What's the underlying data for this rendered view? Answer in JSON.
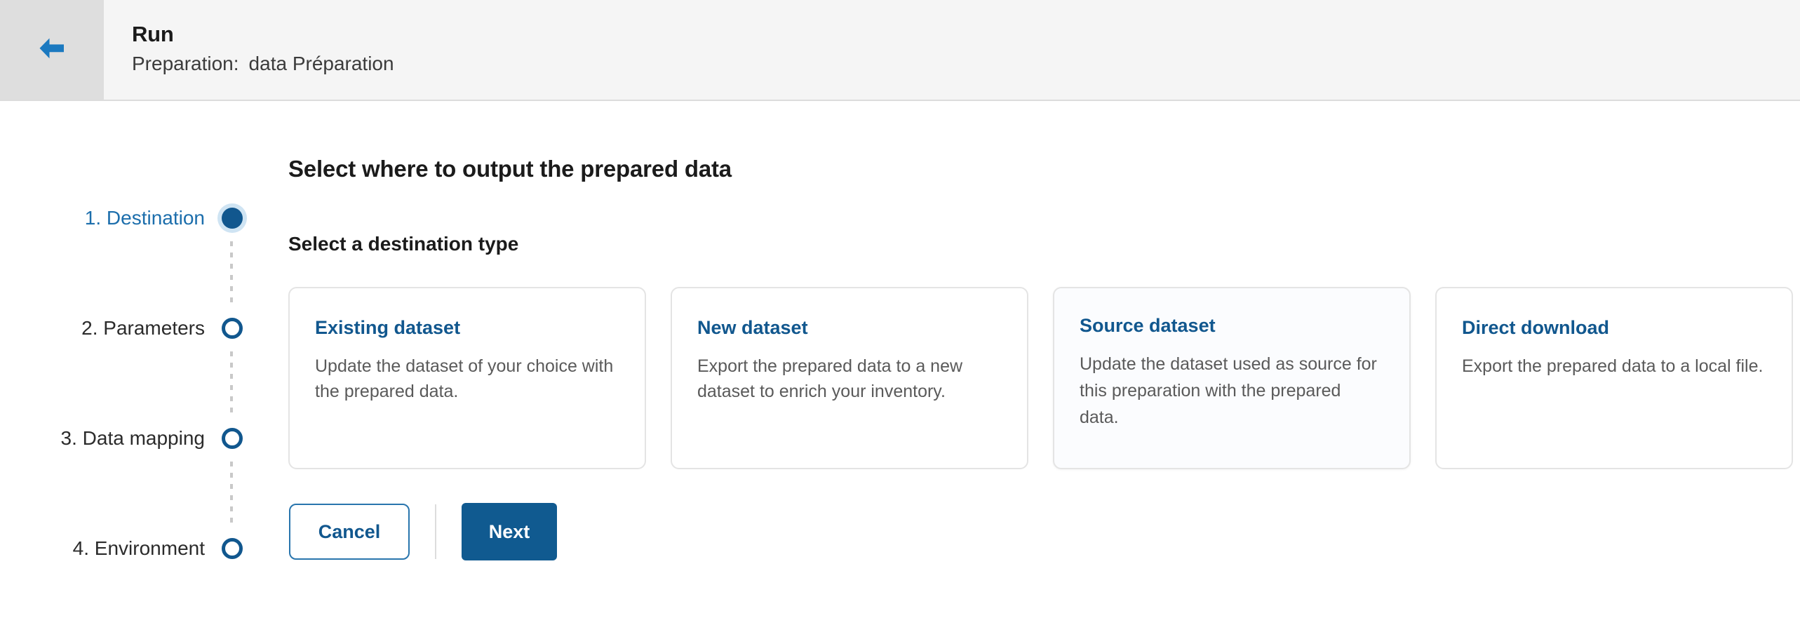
{
  "header": {
    "back_icon": "arrow-left-icon",
    "title": "Run",
    "subtitle_label": "Preparation:",
    "subtitle_value": "data Préparation"
  },
  "stepper": {
    "steps": [
      {
        "label": "1. Destination",
        "state": "active"
      },
      {
        "label": "2. Parameters",
        "state": "upcoming"
      },
      {
        "label": "3. Data mapping",
        "state": "upcoming"
      },
      {
        "label": "4. Environment",
        "state": "upcoming"
      }
    ]
  },
  "main": {
    "page_title": "Select where to output the prepared data",
    "section_title": "Select a destination type",
    "cards": [
      {
        "title": "Existing dataset",
        "description": "Update the dataset of your choice with the prepared data.",
        "state": "default"
      },
      {
        "title": "New dataset",
        "description": "Export the prepared data to a new dataset to enrich your inventory.",
        "state": "default"
      },
      {
        "title": "Source dataset",
        "description": "Update the dataset used as source for this preparation with the prepared data.",
        "state": "hovered"
      },
      {
        "title": "Direct download",
        "description": "Export the prepared data to a local file.",
        "state": "default"
      }
    ]
  },
  "actions": {
    "cancel_label": "Cancel",
    "next_label": "Next"
  },
  "colors": {
    "accent_blue": "#11578e",
    "accent_blue_light": "#1c6eac",
    "halo_blue": "#cfe4f3",
    "header_bg": "#f5f5f5",
    "back_bg": "#dedede",
    "card_border": "#e4e4e4",
    "body_text": "#5a5a5a"
  }
}
